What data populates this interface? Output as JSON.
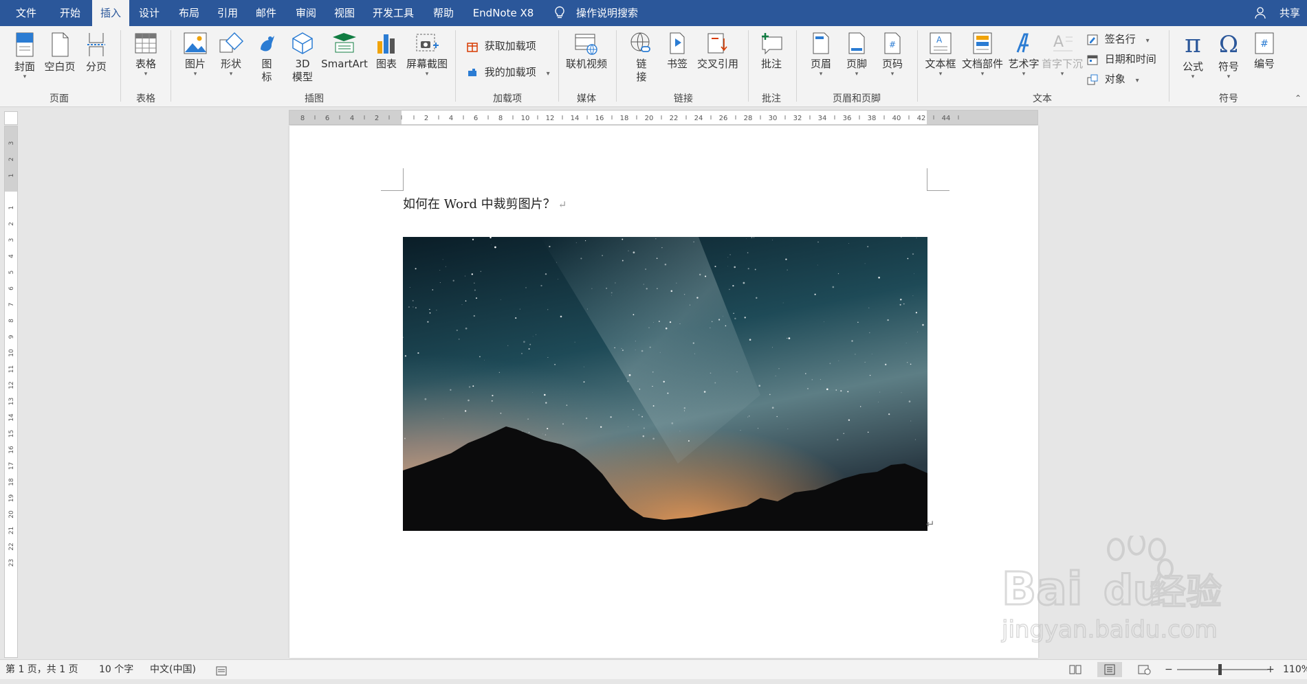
{
  "tabs": [
    {
      "label": "文件"
    },
    {
      "label": "开始"
    },
    {
      "label": "插入",
      "active": true
    },
    {
      "label": "设计"
    },
    {
      "label": "布局"
    },
    {
      "label": "引用"
    },
    {
      "label": "邮件"
    },
    {
      "label": "审阅"
    },
    {
      "label": "视图"
    },
    {
      "label": "开发工具"
    },
    {
      "label": "帮助"
    },
    {
      "label": "EndNote X8"
    }
  ],
  "tell_me": "操作说明搜索",
  "share": "共享",
  "ribbon": {
    "pages_group": {
      "label": "页面",
      "cover": "封面",
      "blank_page": "空白页",
      "page_break": "分页"
    },
    "tables_group": {
      "label": "表格",
      "table": "表格"
    },
    "illustrations_group": {
      "label": "插图",
      "pictures": "图片",
      "shapes": "形状",
      "icons_line1": "图",
      "icons_line2": "标",
      "model_line1": "3D",
      "model_line2": "模型",
      "smartart": "SmartArt",
      "chart": "图表",
      "screenshot": "屏幕截图"
    },
    "addins_group": {
      "label": "加载项",
      "get_addins": "获取加载项",
      "my_addins": "我的加载项"
    },
    "media_group": {
      "label": "媒体",
      "online_video": "联机视频"
    },
    "links_group": {
      "label": "链接",
      "link_line1": "链",
      "link_line2": "接",
      "bookmark": "书签",
      "cross_ref": "交叉引用"
    },
    "comments_group": {
      "label": "批注",
      "comment": "批注"
    },
    "header_footer_group": {
      "label": "页眉和页脚",
      "header": "页眉",
      "footer": "页脚",
      "page_number": "页码"
    },
    "text_group": {
      "label": "文本",
      "textbox": "文本框",
      "quick_parts": "文档部件",
      "wordart": "艺术字",
      "drop_cap": "首字下沉",
      "signature_line": "签名行",
      "date_time": "日期和时间",
      "object": "对象"
    },
    "symbols_group": {
      "label": "符号",
      "equation": "公式",
      "symbol": "符号",
      "number": "编号"
    }
  },
  "document": {
    "heading": "如何在 Word 中裁剪图片？",
    "para_mark": "↵"
  },
  "status": {
    "page": "第 1 页，共 1 页",
    "words": "10 个字",
    "language": "中文(中国)",
    "zoom": "110%"
  },
  "watermark": {
    "brand": "Bai",
    "brand2": "du",
    "cn": "经验",
    "url": "jingyan.baidu.com"
  },
  "colors": {
    "accent": "#2b579a",
    "ribbon": "#f3f3f3",
    "canvas": "#e6e6e6"
  }
}
